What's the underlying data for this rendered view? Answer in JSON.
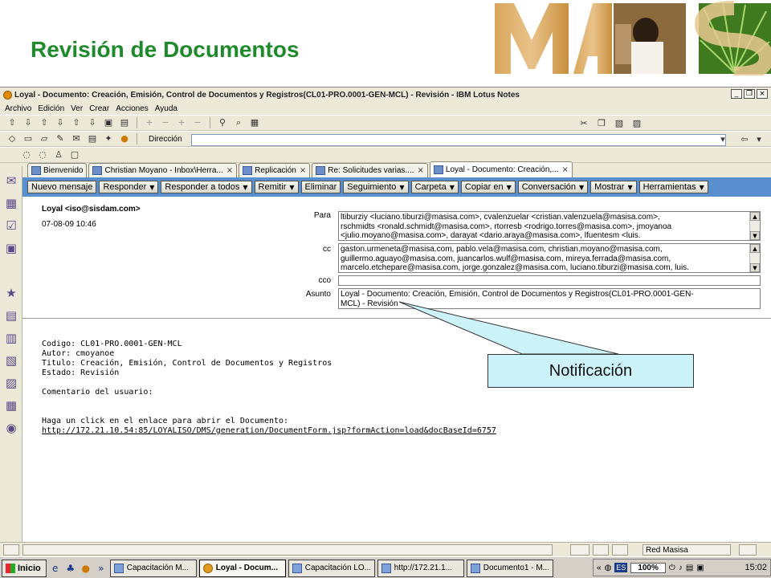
{
  "slide": {
    "title": "Revisión de Documentos",
    "logo_text": "MAS",
    "callout": "Notificación"
  },
  "window": {
    "title": "Loyal - Documento: Creación, Emisión, Control de Documentos y Registros(CL01-PRO.0001-GEN-MCL) - Revisión  - IBM Lotus Notes",
    "buttons": {
      "minimize": "_",
      "restore": "❐",
      "close": "×"
    }
  },
  "menu": [
    "Archivo",
    "Edición",
    "Ver",
    "Crear",
    "Acciones",
    "Ayuda"
  ],
  "toolbar": {
    "address_label": "Dirección",
    "address_value": ""
  },
  "tabs": [
    {
      "label": "Bienvenido",
      "close": ""
    },
    {
      "label": "Christian Moyano - Inbox\\Herra...",
      "close": "×"
    },
    {
      "label": "Replicación",
      "close": "×"
    },
    {
      "label": "Re: Solicitudes varias....",
      "close": "×"
    },
    {
      "label": "Loyal - Documento: Creación,...",
      "close": "×"
    }
  ],
  "actions": [
    {
      "label": "Nuevo mensaje",
      "caret": ""
    },
    {
      "label": "Responder",
      "caret": "▼"
    },
    {
      "label": "Responder a todos",
      "caret": "▼"
    },
    {
      "label": "Remitir",
      "caret": "▼"
    },
    {
      "label": "Eliminar",
      "caret": ""
    },
    {
      "label": "Seguimiento",
      "caret": "▼"
    },
    {
      "label": "Carpeta",
      "caret": "▼"
    },
    {
      "label": "Copiar en",
      "caret": "▼"
    },
    {
      "label": "Conversación",
      "caret": "▼"
    },
    {
      "label": "Mostrar",
      "caret": "▼"
    },
    {
      "label": "Herramientas",
      "caret": "▼"
    }
  ],
  "memo": {
    "from": "Loyal <iso@sisdam.com>",
    "date": "07-08-09 10:46",
    "labels": {
      "to": "Para",
      "cc": "cc",
      "bcc": "cco",
      "subject": "Asunto"
    },
    "to_lines": [
      "ltiburziy <luciano.tiburzi@masisa.com>, cvalenzuelar <cristian.valenzuela@masisa.com>,",
      "rschmidts <ronald.schmidt@masisa.com>, rtorresb <rodrigo.torres@masisa.com>, jmoyanoa",
      "<julio.moyano@masisa.com>, darayat <dario.araya@masisa.com>, lfuentesm <luis."
    ],
    "cc_lines": [
      "gaston.urmeneta@masisa.com, pablo.vela@masisa.com, christian.moyano@masisa.com,",
      "guillermo.aguayo@masisa.com, juancarlos.wulf@masisa.com, mireya.ferrada@masisa.com,",
      "marcelo.etchepare@masisa.com, jorge.gonzalez@masisa.com, luciano.tiburzi@masisa.com, luis."
    ],
    "bcc": "",
    "subject_lines": [
      "Loyal - Documento: Creación, Emisión, Control de Documentos y Registros(CL01-PRO.0001-GEN-",
      "MCL) - Revisión"
    ],
    "body_lines": [
      "Codigo: CL01-PRO.0001-GEN-MCL",
      "Autor: cmoyanoe",
      "Titulo: Creación, Emisión, Control de Documentos y Registros",
      "Estado: Revisión",
      "",
      "Comentario del usuario:",
      "",
      "",
      "Haga un click en el enlace para abrir el Documento:"
    ],
    "link": "http://172.21.10.54:85/LOYALISO/DMS/generation/DocumentForm.jsp?formAction=load&docBaseId=6757"
  },
  "statusbar": {
    "network": "Red Masisa"
  },
  "taskbar": {
    "start": "Inicio",
    "chevron": "»",
    "tasks": [
      {
        "label": "Capacitación M...",
        "active": false
      },
      {
        "label": "Loyal - Docum...",
        "active": true
      },
      {
        "label": "Capacitación LO...",
        "active": false
      },
      {
        "label": "http://172.21.1...",
        "active": false
      },
      {
        "label": "Documento1 - M...",
        "active": false
      }
    ],
    "tray": {
      "lang": "ES",
      "zoom": "100%",
      "clock": "15:02"
    }
  }
}
